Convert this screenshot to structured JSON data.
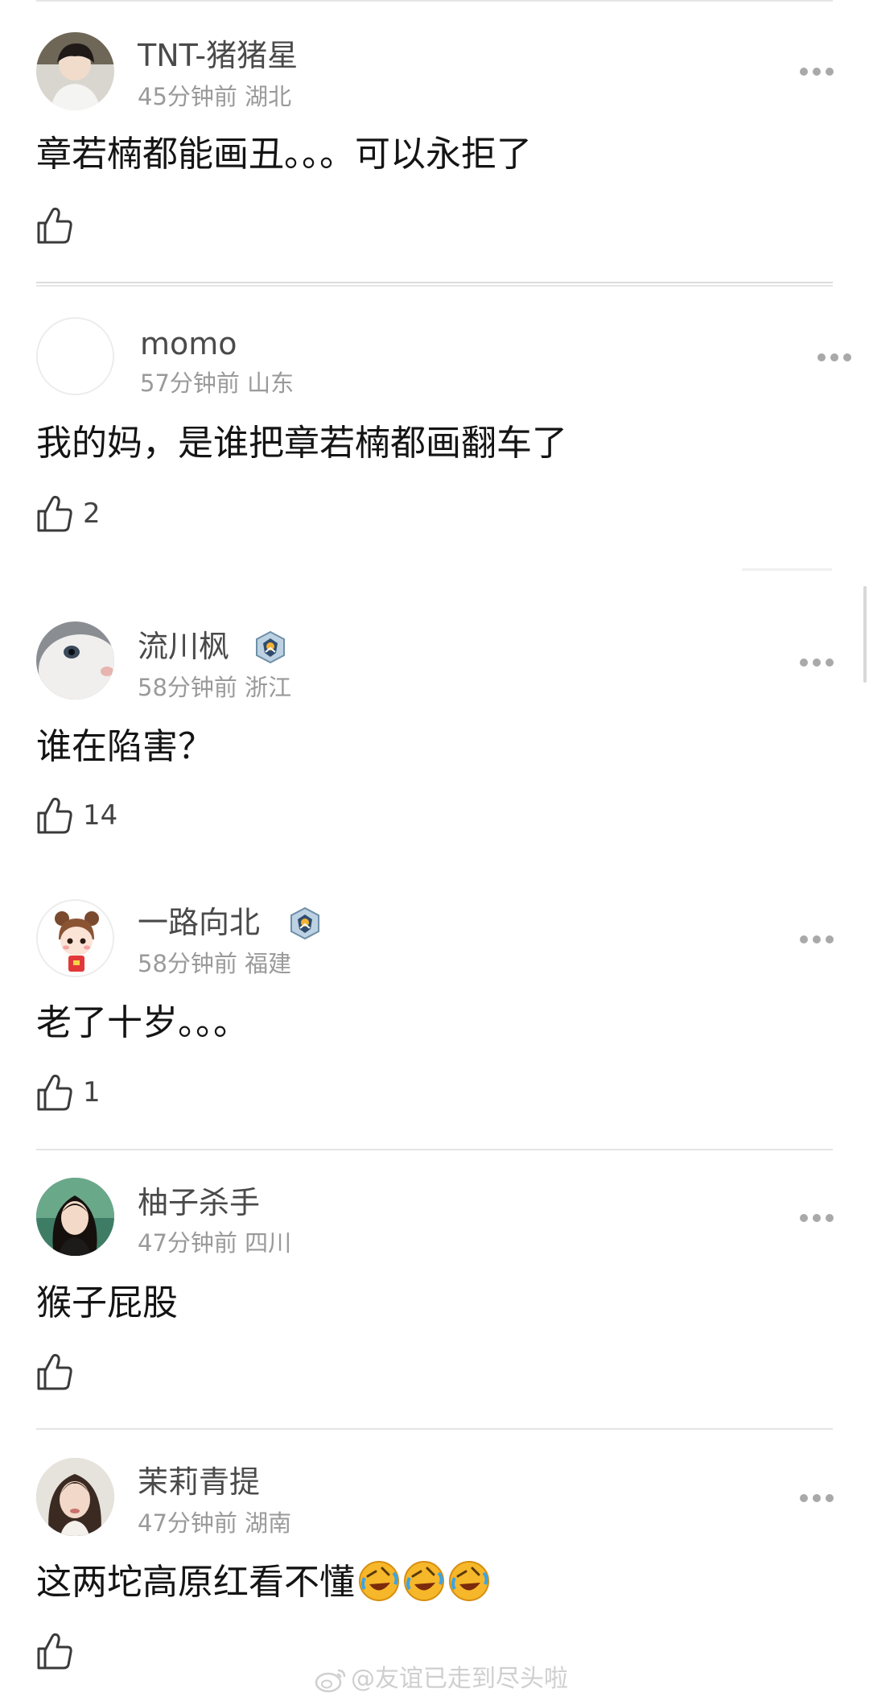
{
  "comments": [
    {
      "username": "TNT-猪猪星",
      "time": "45分钟前",
      "location": "湖北",
      "text": "章若楠都能画丑。。。可以永拒了",
      "likes": "",
      "avatar": "young-man-avatar",
      "badge": false
    },
    {
      "username": "momo",
      "time": "57分钟前",
      "location": "山东",
      "text": "我的妈，是谁把章若楠都画翻车了",
      "likes": "2",
      "avatar": "blank-avatar",
      "badge": false
    },
    {
      "username": "流川枫",
      "time": "58分钟前",
      "location": "浙江",
      "text": "谁在陷害？",
      "likes": "14",
      "avatar": "white-cat-avatar",
      "badge": true
    },
    {
      "username": "一路向北",
      "time": "58分钟前",
      "location": "福建",
      "text": "老了十岁。。。",
      "likes": "1",
      "avatar": "cartoon-girl-avatar",
      "badge": true
    },
    {
      "username": "柚子杀手",
      "time": "47分钟前",
      "location": "四川",
      "text": "猴子屁股",
      "likes": "",
      "avatar": "woman-portrait-avatar",
      "badge": false
    },
    {
      "username": "茉莉青提",
      "time": "47分钟前",
      "location": "湖南",
      "text": "这两坨高原红看不懂",
      "likes": "",
      "avatar": "woman-portrait-avatar",
      "badge": false,
      "emojis": [
        "rolling-laughing-emoji",
        "rolling-laughing-emoji",
        "rolling-laughing-emoji"
      ]
    }
  ],
  "watermark": "@友谊已走到尽头啦",
  "colors": {
    "username": "#4a4a4a",
    "meta": "#9a9a9a",
    "text": "#141414",
    "divider": "#e4e4e4",
    "emoji_yellow": "#f6b72a"
  }
}
